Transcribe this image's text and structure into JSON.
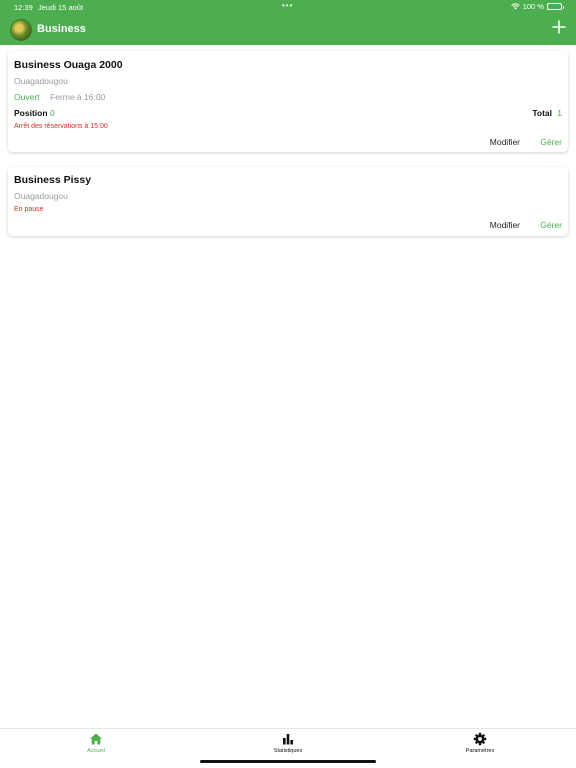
{
  "status_bar": {
    "time": "12:39",
    "date": "Jeudi 15 août",
    "battery": "100 %"
  },
  "header": {
    "title": "Business"
  },
  "businesses": [
    {
      "name": "Business Ouaga 2000",
      "city": "Ouagadougou",
      "status": "Ouvert",
      "closing": "Ferme à 16:00",
      "position_label": "Position",
      "position_value": "0",
      "total_label": "Total",
      "total_value": "1",
      "note": "Arrêt des réservations à 15:00",
      "modify_label": "Modifier",
      "manage_label": "Gérer"
    },
    {
      "name": "Business Pissy",
      "city": "Ouagadougou",
      "note": "En pause",
      "modify_label": "Modifier",
      "manage_label": "Gérer"
    }
  ],
  "tabs": [
    {
      "label": "Accueil",
      "icon": "home-icon",
      "active": true
    },
    {
      "label": "Statistiques",
      "icon": "bar-chart-icon",
      "active": false
    },
    {
      "label": "Paramètres",
      "icon": "gear-icon",
      "active": false
    }
  ],
  "colors": {
    "brand": "#4cae4f",
    "warning": "#d93025",
    "muted": "#9a9a9a"
  }
}
